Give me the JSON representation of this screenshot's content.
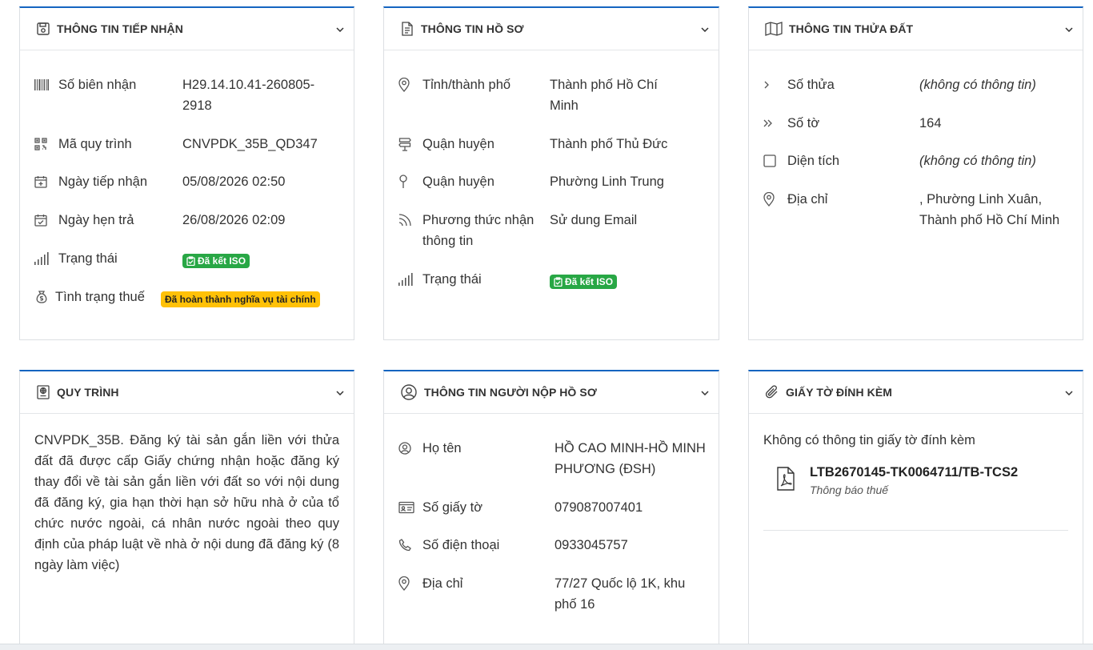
{
  "cards": {
    "tiep_nhan": {
      "title": "THÔNG TIN TIẾP NHẬN",
      "rows": [
        {
          "label": "Số biên nhận",
          "value": "H29.14.10.41-260805-2918"
        },
        {
          "label": "Mã quy trình",
          "value": "CNVPDK_35B_QD347"
        },
        {
          "label": "Ngày tiếp nhận",
          "value": "05/08/2026 02:50"
        },
        {
          "label": "Ngày hẹn trả",
          "value": "26/08/2026 02:09"
        },
        {
          "label": "Trạng thái",
          "value": "Đã kết ISO"
        },
        {
          "label": "Tình trạng thuế",
          "value": "Đã hoàn thành nghĩa vụ tài chính"
        }
      ]
    },
    "ho_so": {
      "title": "THÔNG TIN HỒ SƠ",
      "rows": [
        {
          "label": "Tỉnh/thành phố",
          "value": "Thành phố Hồ Chí Minh"
        },
        {
          "label": "Quận huyện",
          "value": "Thành phố Thủ Đức"
        },
        {
          "label": "Quận huyện",
          "value": "Phường Linh Trung"
        },
        {
          "label": "Phương thức nhận thông tin",
          "value": "Sử dung Email"
        },
        {
          "label": "Trạng thái",
          "value": "Đã kết ISO"
        }
      ]
    },
    "thua_dat": {
      "title": "THÔNG TIN THỬA ĐẤT",
      "rows": [
        {
          "label": "Số thửa",
          "value": "(không có thông tin)"
        },
        {
          "label": "Số tờ",
          "value": "164"
        },
        {
          "label": "Diện tích",
          "value": "(không có thông tin)"
        },
        {
          "label": "Địa chỉ",
          "value": ", Phường Linh Xuân, Thành phố Hồ Chí Minh"
        }
      ]
    },
    "quy_trinh": {
      "title": "QUY TRÌNH",
      "description": "CNVPDK_35B. Đăng ký tài sản gắn liền với thửa đất đã được cấp Giấy chứng nhận hoặc đăng ký thay đổi về tài sản gắn liền với đất so với nội dung đã đăng ký, gia hạn thời hạn sở hữu nhà ở của tổ chức nước ngoài, cá nhân nước ngoài theo quy định của pháp luật về nhà ở nội dung đã đăng ký (8 ngày làm việc)"
    },
    "nguoi_nop": {
      "title": "THÔNG TIN NGƯỜI NỘP HỒ SƠ",
      "rows": [
        {
          "label": "Họ tên",
          "value": "HỒ CAO MINH-HỒ MINH PHƯƠNG (ĐSH)"
        },
        {
          "label": "Số giấy tờ",
          "value": "079087007401"
        },
        {
          "label": "Số điện thoại",
          "value": "0933045757"
        },
        {
          "label": "Địa chỉ",
          "value": "77/27 Quốc lộ 1K, khu phố 16"
        }
      ]
    },
    "giay_to": {
      "title": "GIẤY TỜ ĐÍNH KÈM",
      "empty_text": "Không có thông tin giấy tờ đính kèm",
      "attachment": {
        "name": "LTB2670145-TK0064711/TB-TCS2",
        "subtitle": "Thông báo thuế"
      }
    }
  },
  "colors": {
    "accent": "#1565c0",
    "badge_green": "#28a745",
    "badge_yellow": "#ffc107",
    "text": "#333333"
  },
  "icons": {
    "tiep_nhan": [
      "barcode-icon",
      "qrcode-icon",
      "calendar-plus-icon",
      "calendar-check-icon",
      "signal-icon",
      "money-bag-icon"
    ],
    "ho_so": [
      "map-pin-icon",
      "signpost-icon",
      "pin-icon",
      "rss-icon",
      "signal-icon"
    ],
    "thua_dat": [
      "chevron-right-icon",
      "double-chevron-right-icon",
      "square-icon",
      "map-pin-icon"
    ],
    "nguoi_nop": [
      "user-circle-icon",
      "id-card-icon",
      "phone-icon",
      "map-pin-icon"
    ]
  }
}
